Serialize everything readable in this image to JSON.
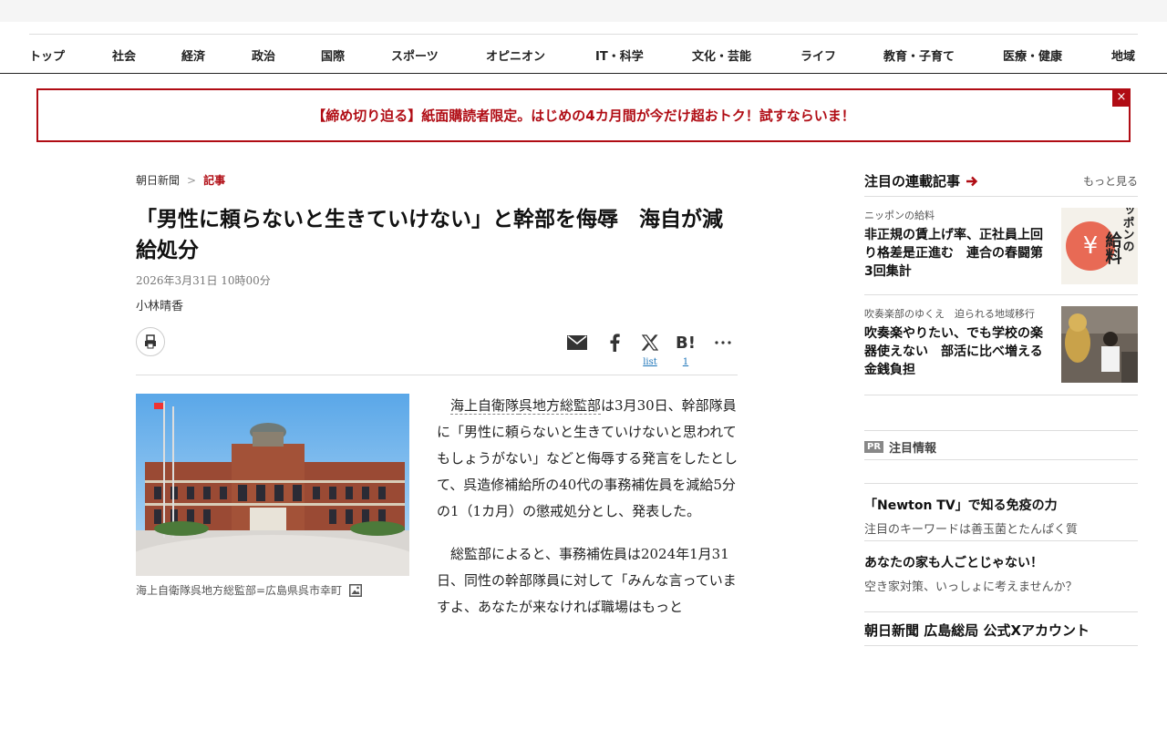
{
  "nav": {
    "items": [
      "トップ",
      "社会",
      "経済",
      "政治",
      "国際",
      "スポーツ",
      "オピニオン",
      "IT・科学",
      "文化・芸能",
      "ライフ",
      "教育・子育て",
      "医療・健康",
      "地域"
    ]
  },
  "banner": {
    "text": "【締め切り迫る】紙面購読者限定。はじめの4カ月間が今だけ超おトク！試すならいま！",
    "close": "×"
  },
  "breadcrumb": {
    "home": "朝日新聞",
    "sep": ">",
    "current": "記事"
  },
  "article": {
    "title": "「男性に頼らないと生きていけない」と幹部を侮辱　海自が減給処分",
    "date": "2026年3月31日 10時00分",
    "author": "小林晴香",
    "share": {
      "x_count": "list",
      "hatena_count": "1",
      "hatena_label": "B!"
    },
    "photo_caption": "海上自衛隊呉地方総監部=広島県呉市幸町",
    "p1_link1": "海上自衛隊",
    "p1_link2": "呉地方総監部",
    "p1_rest": "は3月30日、幹部隊員に「男性に頼らないと生きていけないと思われてもしょうがない」などと侮辱する発言をしたとして、呉造修補給所の40代の事務補佐員を減給5分の1（1カ月）の懲戒処分とし、発表した。",
    "p2": "総監部によると、事務補佐員は2024年1月31日、同性の幹部隊員に対して「みんな言っていますよ、あなたが来なければ職場はもっと"
  },
  "sidebar": {
    "title": "注目の連載記事",
    "more": "もっと見る",
    "items": [
      {
        "series": "ニッポンの給料",
        "headline": "非正規の賃上げ率、正社員上回り格差是正進む　連合の春闘第3回集計",
        "thumb_text": "ニッポンの給料"
      },
      {
        "series": "吹奏楽部のゆくえ　迫られる地域移行",
        "headline": "吹奏楽やりたい、でも学校の楽器使えない　部活に比べ増える金銭負担"
      }
    ],
    "pr_badge": "PR",
    "pr_title": "注目情報",
    "pr_items": [
      {
        "title": "「Newton TV」で知る免疫の力",
        "sub": "注目のキーワードは善玉菌とたんぱく質"
      },
      {
        "title": "あなたの家も人ごとじゃない！",
        "sub": "空き家対策、いっしょに考えませんか？"
      }
    ],
    "x_account": "朝日新聞 広島総局 公式Xアカウント"
  },
  "colors": {
    "accent": "#b00c14",
    "link": "#1a73b8"
  }
}
